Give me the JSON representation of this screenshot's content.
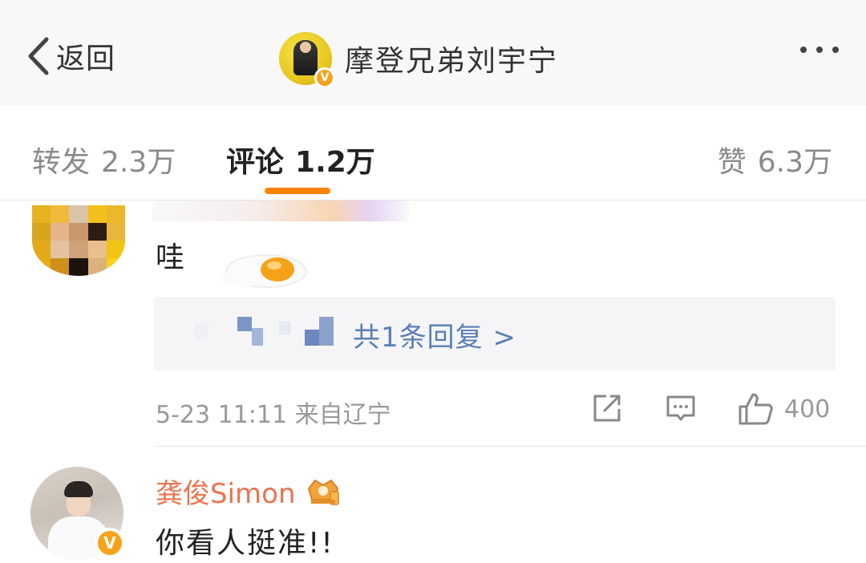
{
  "header": {
    "back_label": "返回",
    "title": "摩登兄弟刘宇宁",
    "verified_badge": "V",
    "more_icon": "more-dots-icon"
  },
  "tabs": [
    {
      "label": "转发",
      "count": "2.3万",
      "active": false
    },
    {
      "label": "评论",
      "count": "1.2万",
      "active": true
    },
    {
      "label": "赞",
      "count": "6.3万",
      "active": false
    }
  ],
  "comments": [
    {
      "text": "哇",
      "replies_link": "共1条回复 >",
      "meta": "5-23 11:11 来自辽宁",
      "likes": "400"
    },
    {
      "user": "龚俊Simon",
      "text": "你看人挺准!!",
      "verified_badge": "V"
    }
  ],
  "colors": {
    "accent": "#ff8200",
    "link": "#5a7fb5",
    "vip_name": "#eb7350",
    "meta": "#999999"
  }
}
